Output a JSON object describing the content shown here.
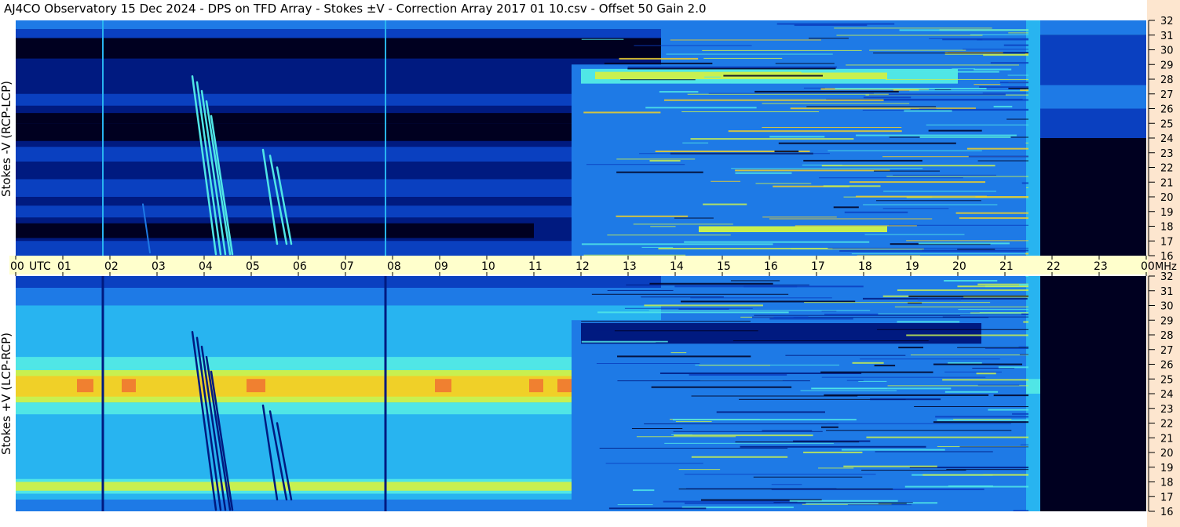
{
  "header": {
    "title": "AJ4CO Observatory  15 Dec 2024  -  DPS on TFD Array  -  Stokes ±V  -  Correction Array 2017 01 10.csv  -  Offset 50  Gain 2.0"
  },
  "chart_data": {
    "type": "heatmap",
    "title": "AJ4CO Observatory  15 Dec 2024  -  DPS on TFD Array  -  Stokes ±V  -  Correction Array 2017 01 10.csv  -  Offset 50  Gain 2.0",
    "x_axis": {
      "label_prefix": "UTC",
      "ticks": [
        "00",
        "01",
        "02",
        "03",
        "04",
        "05",
        "06",
        "07",
        "08",
        "09",
        "10",
        "11",
        "12",
        "13",
        "14",
        "15",
        "16",
        "17",
        "18",
        "19",
        "20",
        "21",
        "22",
        "23",
        "00"
      ],
      "range_hours": [
        0,
        24
      ]
    },
    "y_axis": {
      "unit": "MHz",
      "ticks": [
        16,
        17,
        18,
        19,
        20,
        21,
        22,
        23,
        24,
        25,
        26,
        27,
        28,
        29,
        30,
        31,
        32
      ],
      "range": [
        16,
        32
      ]
    },
    "panels": [
      {
        "name": "Stokes -V (RCP-LCP)"
      },
      {
        "name": "Stokes +V (LCP-RCP)"
      }
    ],
    "colormap": [
      "#000020",
      "#001a80",
      "#0a40c0",
      "#1e7ae6",
      "#28b4f0",
      "#50e6e6",
      "#c8f050",
      "#f0d028",
      "#f08030"
    ]
  }
}
